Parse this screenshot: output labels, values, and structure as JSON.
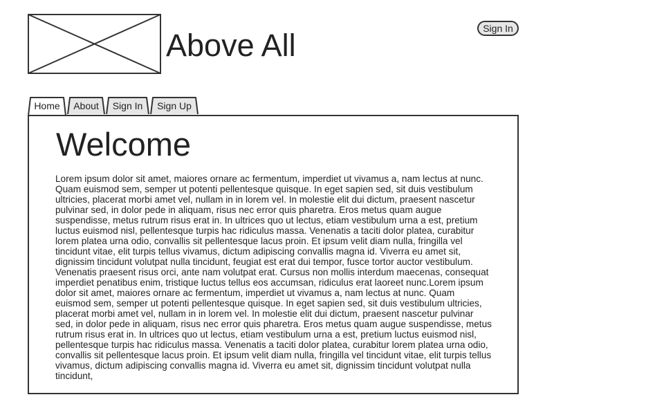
{
  "header": {
    "logo_icon": "image-placeholder-icon",
    "site_title": "Above All",
    "signin_button": "Sign In"
  },
  "nav": {
    "tabs": [
      {
        "label": "Home",
        "active": true
      },
      {
        "label": "About",
        "active": false
      },
      {
        "label": "Sign In",
        "active": false
      },
      {
        "label": "Sign Up",
        "active": false
      }
    ]
  },
  "main": {
    "heading": "Welcome",
    "body": "Lorem ipsum dolor sit amet, maiores ornare ac fermentum, imperdiet ut vivamus a, nam lectus at nunc. Quam euismod sem, semper ut potenti pellentesque quisque. In eget sapien sed, sit duis vestibulum ultricies, placerat morbi amet vel, nullam in in lorem vel. In molestie elit dui dictum, praesent nascetur pulvinar sed, in dolor pede in aliquam, risus nec error quis pharetra. Eros metus quam augue suspendisse, metus rutrum risus erat in.  In ultrices quo ut lectus, etiam vestibulum urna a est, pretium luctus euismod nisl, pellentesque turpis hac ridiculus massa. Venenatis a taciti dolor platea, curabitur lorem platea urna odio, convallis sit pellentesque lacus proin. Et ipsum velit diam nulla, fringilla vel tincidunt vitae, elit turpis tellus vivamus, dictum adipiscing convallis magna id. Viverra eu amet sit, dignissim tincidunt volutpat nulla tincidunt, feugiat est erat dui tempor, fusce tortor auctor vestibulum. Venenatis praesent risus orci, ante nam volutpat erat. Cursus non mollis interdum maecenas, consequat imperdiet penatibus enim, tristique luctus tellus eos accumsan, ridiculus erat laoreet nunc.Lorem ipsum dolor sit amet, maiores ornare ac fermentum, imperdiet ut vivamus a, nam lectus at nunc. Quam euismod sem, semper ut potenti pellentesque quisque. In eget sapien sed, sit duis vestibulum ultricies, placerat morbi amet vel, nullam in in lorem vel. In molestie elit dui dictum, praesent nascetur pulvinar sed, in dolor pede in aliquam, risus nec error quis pharetra. Eros metus quam augue suspendisse, metus rutrum risus erat in.  In ultrices quo ut lectus, etiam vestibulum urna a est, pretium luctus euismod nisl, pellentesque turpis hac ridiculus massa. Venenatis a taciti dolor platea, curabitur lorem platea urna odio, convallis sit pellentesque lacus proin. Et ipsum velit diam nulla, fringilla vel tincidunt vitae, elit turpis tellus vivamus, dictum adipiscing convallis magna id. Viverra eu amet sit, dignissim tincidunt volutpat nulla tincidunt,"
  },
  "colors": {
    "border": "#333333",
    "tab_inactive_fill": "#e6e6e6",
    "tab_active_fill": "#ffffff",
    "text": "#222222"
  }
}
